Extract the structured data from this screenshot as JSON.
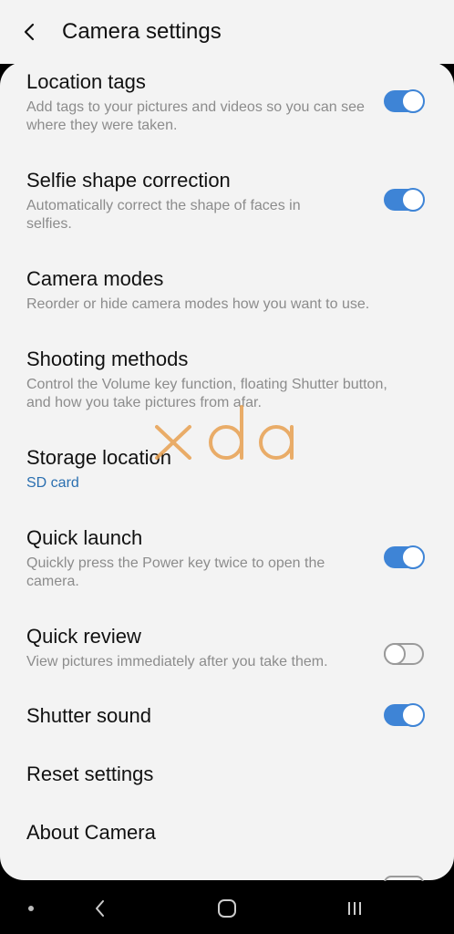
{
  "header": {
    "title": "Camera settings"
  },
  "settings": [
    {
      "title": "Location tags",
      "subtitle": "Add tags to your pictures and videos so you can see where they were taken.",
      "toggle": "on"
    },
    {
      "title": "Selfie shape correction",
      "subtitle": "Automatically correct the shape of faces in selfies.",
      "toggle": "on"
    },
    {
      "title": "Camera modes",
      "subtitle": "Reorder or hide camera modes how you want to use.",
      "toggle": null
    },
    {
      "title": "Shooting methods",
      "subtitle": "Control the Volume key function, floating Shutter button, and how you take pictures from afar.",
      "toggle": null
    },
    {
      "title": "Storage location",
      "subtitle": "SD card",
      "toggle": null
    },
    {
      "title": "Quick launch",
      "subtitle": "Quickly press the Power key twice to open the camera.",
      "toggle": "on"
    },
    {
      "title": "Quick review",
      "subtitle": "View pictures immediately after you take them.",
      "toggle": "off"
    },
    {
      "title": "Shutter sound",
      "subtitle": "",
      "toggle": "on"
    },
    {
      "title": "Reset settings",
      "subtitle": "",
      "toggle": null
    },
    {
      "title": "About Camera",
      "subtitle": "",
      "toggle": null
    }
  ],
  "watermark": {
    "text": "xda",
    "color": "#e8a050"
  },
  "colors": {
    "accent": "#3e84d6",
    "link": "#2a6fb0",
    "background": "#f3f3f3"
  },
  "icons": {
    "back": "chevron-left-icon",
    "nav_recent": "dot-icon",
    "nav_back": "chevron-left-icon",
    "nav_home": "rounded-square-icon",
    "nav_recents": "three-bars-icon"
  }
}
